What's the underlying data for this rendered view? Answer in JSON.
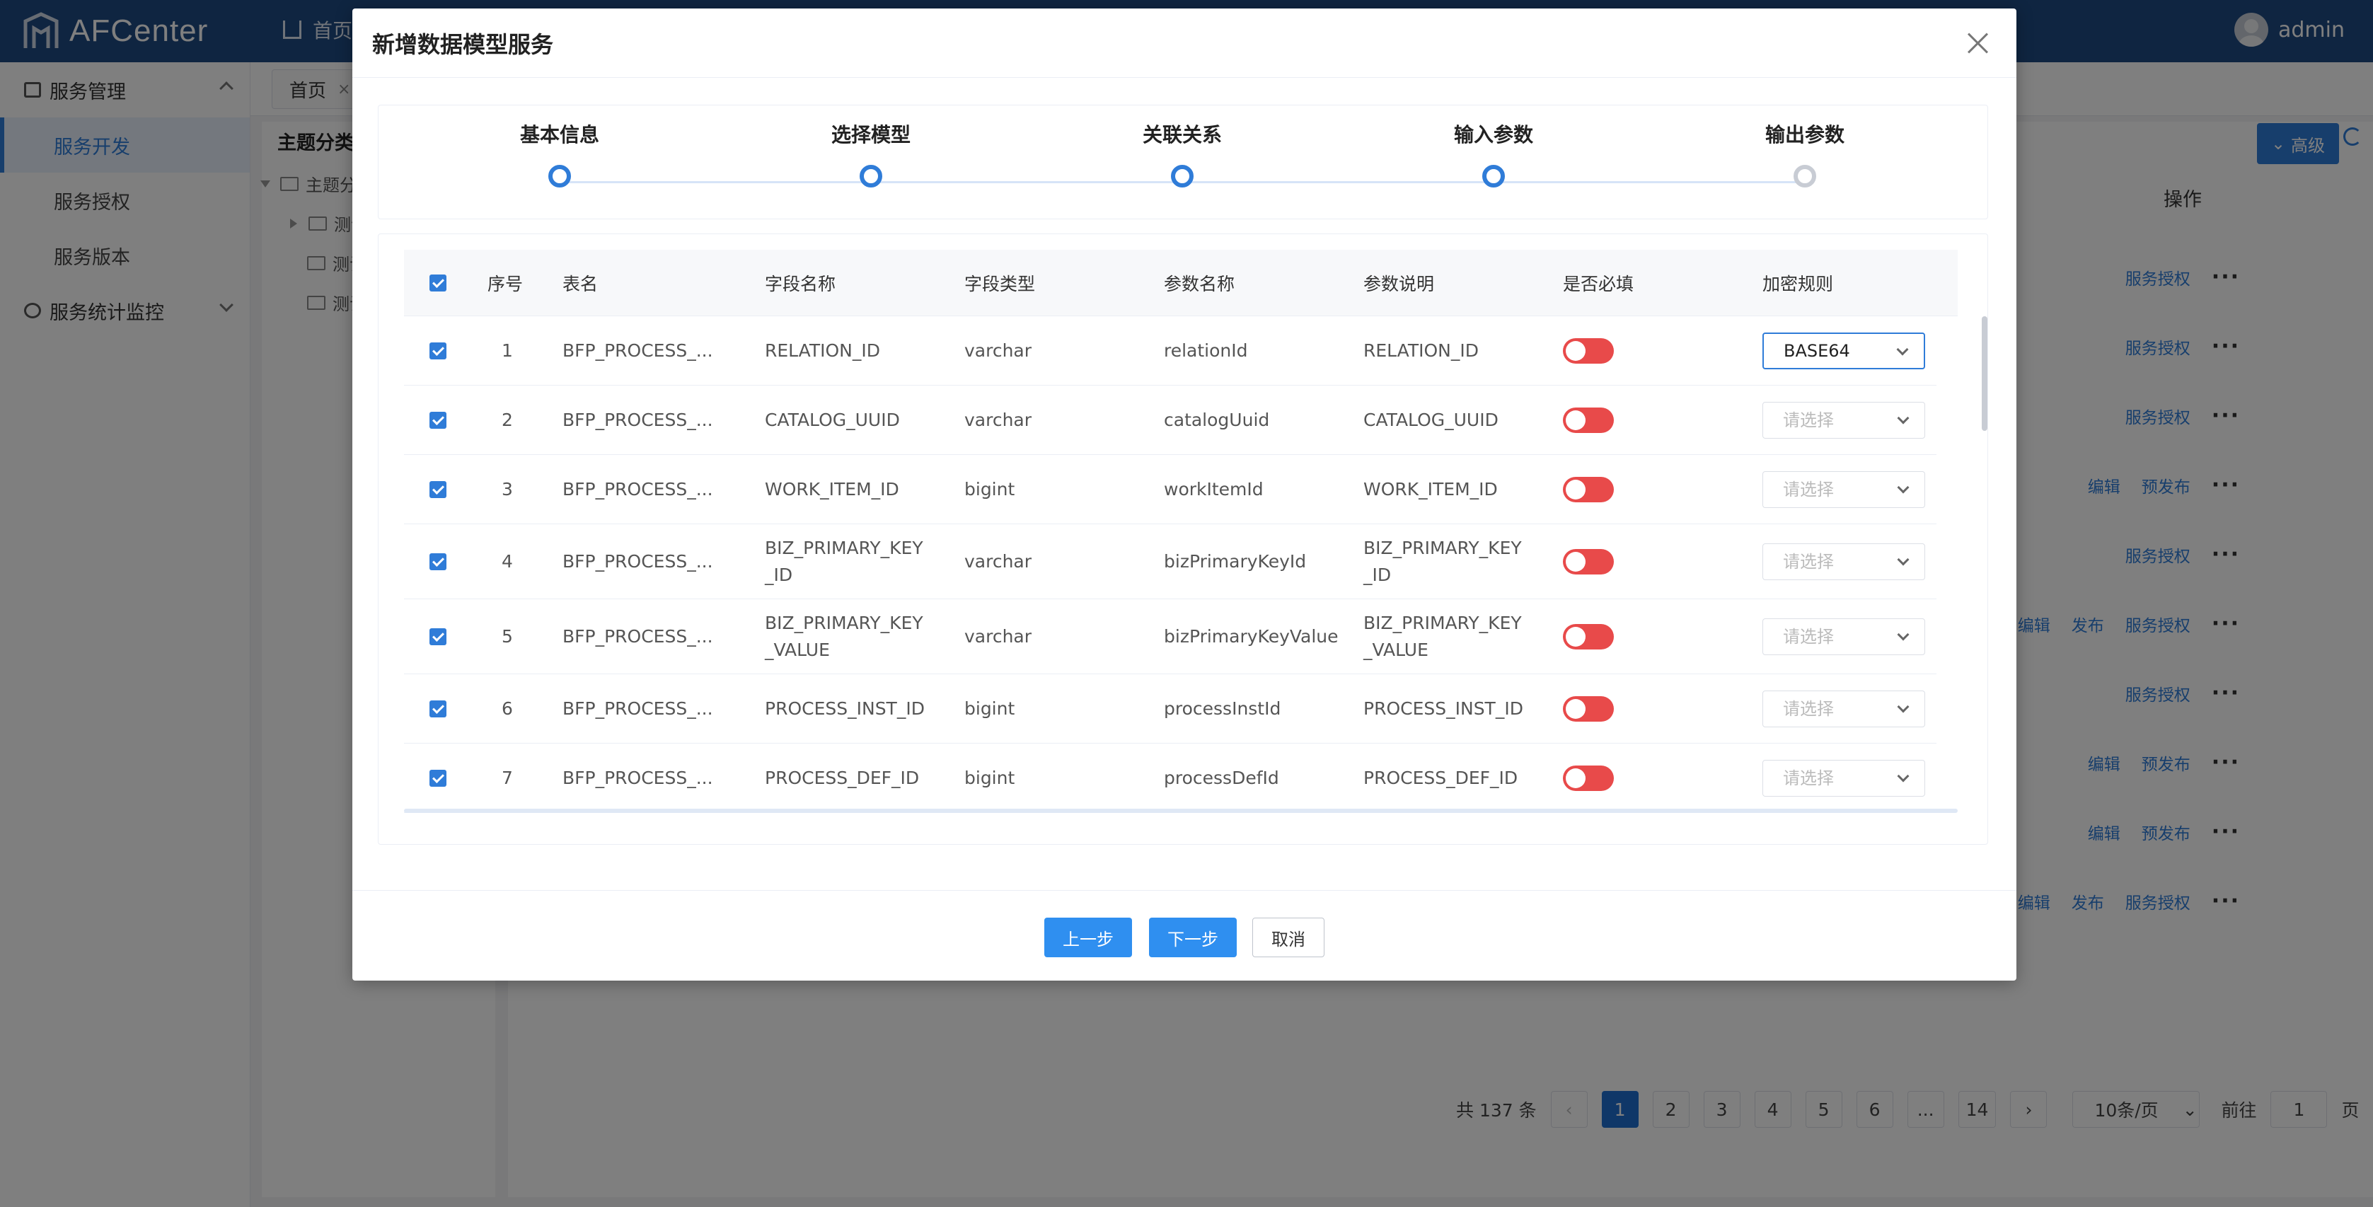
{
  "app": {
    "brand": "AFCenter",
    "nav_home": "首页",
    "user": "admin"
  },
  "sidebar": {
    "groups": [
      {
        "label": "服务管理",
        "items": [
          "服务开发",
          "服务授权",
          "服务版本"
        ]
      },
      {
        "label": "服务统计监控"
      }
    ]
  },
  "tabs": [
    {
      "label": "首页",
      "close": "×"
    }
  ],
  "tree": {
    "title": "主题分类",
    "root": "主题分",
    "children": [
      "测试",
      "测试",
      "测试"
    ]
  },
  "main": {
    "advanced_label": "高级",
    "ops_header": "操作",
    "row_ops": [
      [
        "服务授权"
      ],
      [
        "服务授权"
      ],
      [
        "服务授权"
      ],
      [
        "编辑",
        "预发布"
      ],
      [
        "服务授权"
      ],
      [
        "编辑",
        "发布",
        "服务授权"
      ],
      [
        "服务授权"
      ],
      [
        "编辑",
        "预发布"
      ],
      [
        "编辑",
        "预发布"
      ],
      [
        "编辑",
        "发布",
        "服务授权"
      ]
    ],
    "more": "···"
  },
  "pagination": {
    "total": "共 137 条",
    "prev": "‹",
    "pages": [
      "1",
      "2",
      "3",
      "4",
      "5",
      "6",
      "...",
      "14"
    ],
    "next": "›",
    "active_page": 1,
    "page_size": "10条/页",
    "goto_label": "前往",
    "goto_value": "1",
    "goto_unit": "页"
  },
  "modal": {
    "title": "新增数据模型服务",
    "steps": [
      {
        "label": "基本信息",
        "done": true
      },
      {
        "label": "选择模型",
        "done": true
      },
      {
        "label": "关联关系",
        "done": true
      },
      {
        "label": "输入参数",
        "done": true
      },
      {
        "label": "输出参数",
        "done": false
      }
    ],
    "columns": [
      "序号",
      "表名",
      "字段名称",
      "字段类型",
      "参数名称",
      "参数说明",
      "是否必填",
      "加密规则"
    ],
    "rows": [
      {
        "no": "1",
        "table": "BFP_PROCESS_...",
        "field": "RELATION_ID",
        "type": "varchar",
        "param": "relationId",
        "desc": "RELATION_ID",
        "required": false,
        "encrypt": "BASE64"
      },
      {
        "no": "2",
        "table": "BFP_PROCESS_...",
        "field": "CATALOG_UUID",
        "type": "varchar",
        "param": "catalogUuid",
        "desc": "CATALOG_UUID",
        "required": false,
        "encrypt": ""
      },
      {
        "no": "3",
        "table": "BFP_PROCESS_...",
        "field": "WORK_ITEM_ID",
        "type": "bigint",
        "param": "workItemId",
        "desc": "WORK_ITEM_ID",
        "required": false,
        "encrypt": ""
      },
      {
        "no": "4",
        "table": "BFP_PROCESS_...",
        "field": "BIZ_PRIMARY_KEY_ID",
        "type": "varchar",
        "param": "bizPrimaryKeyId",
        "desc": "BIZ_PRIMARY_KEY_ID",
        "required": false,
        "encrypt": ""
      },
      {
        "no": "5",
        "table": "BFP_PROCESS_...",
        "field": "BIZ_PRIMARY_KEY_VALUE",
        "type": "varchar",
        "param": "bizPrimaryKeyValue",
        "desc": "BIZ_PRIMARY_KEY_VALUE",
        "required": false,
        "encrypt": ""
      },
      {
        "no": "6",
        "table": "BFP_PROCESS_...",
        "field": "PROCESS_INST_ID",
        "type": "bigint",
        "param": "processInstId",
        "desc": "PROCESS_INST_ID",
        "required": false,
        "encrypt": ""
      },
      {
        "no": "7",
        "table": "BFP_PROCESS_...",
        "field": "PROCESS_DEF_ID",
        "type": "bigint",
        "param": "processDefId",
        "desc": "PROCESS_DEF_ID",
        "required": false,
        "encrypt": ""
      }
    ],
    "select_placeholder": "请选择",
    "buttons": {
      "prev": "上一步",
      "next": "下一步",
      "cancel": "取消"
    }
  },
  "colors": {
    "primary": "#2f7cd8",
    "topbar": "#1f4a82",
    "toggle_off": "#e84a4a"
  }
}
